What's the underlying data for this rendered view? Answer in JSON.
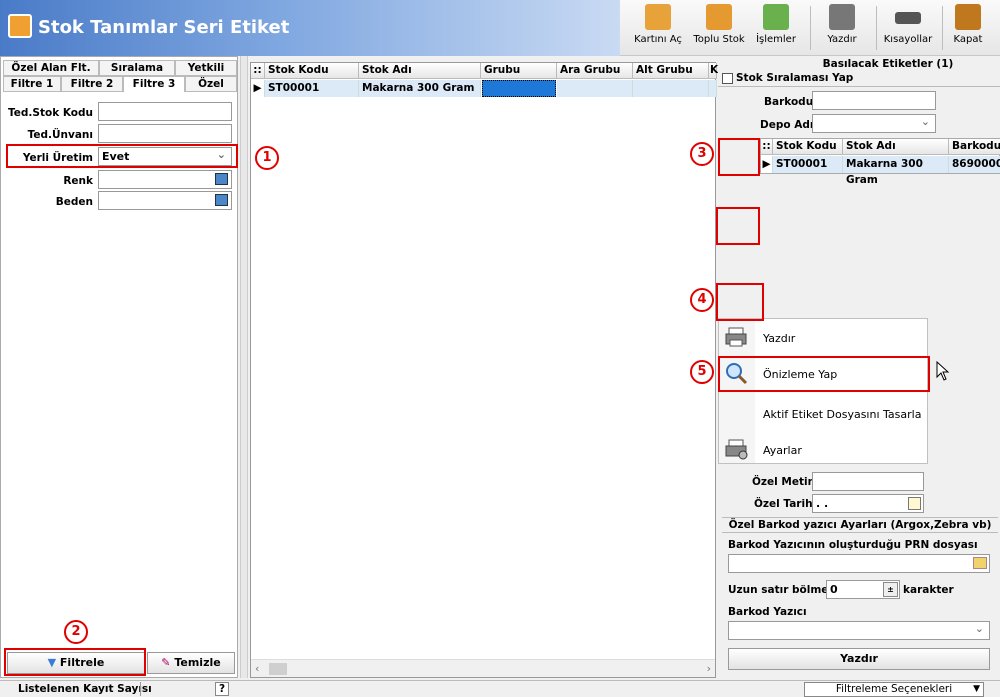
{
  "window": {
    "title": "Stok Tanımlar Seri Etiket"
  },
  "toolbar": {
    "items": [
      "Kartını Aç",
      "Toplu Stok",
      "İşlemler",
      "Yazdır",
      "Kısayollar",
      "Kapat"
    ]
  },
  "left": {
    "tabs_row1": [
      "Özel Alan Flt.",
      "Sıralama",
      "Yetkili"
    ],
    "tabs_row2": [
      "Filtre 1",
      "Filtre 2",
      "Filtre 3",
      "Özel"
    ],
    "fields": {
      "ted_stok_kodu": "Ted.Stok Kodu",
      "ted_unvani": "Ted.Ünvanı",
      "yerli_uretim": "Yerli Üretim",
      "yerli_uretim_value": "Evet",
      "renk": "Renk",
      "beden": "Beden"
    },
    "filter_button": "Filtrele",
    "clear_button": "Temizle"
  },
  "grid": {
    "columns": [
      "Stok Kodu",
      "Stok Adı",
      "Grubu",
      "Ara Grubu",
      "Alt Grubu",
      "K"
    ],
    "rows": [
      [
        "ST00001",
        "Makarna 300 Gram",
        "",
        "",
        "",
        ""
      ]
    ]
  },
  "right": {
    "header": "Basılacak Etiketler (1)",
    "sort_checkbox": "Stok Sıralaması Yap",
    "barkodu_label": "Barkodu",
    "depo_label": "Depo Adı",
    "columns": [
      "Stok Kodu",
      "Stok Adı",
      "Barkodu"
    ],
    "rows": [
      [
        "ST00001",
        "Makarna 300 Gram",
        "8690000"
      ]
    ],
    "ozel_metin": "Özel Metin",
    "ozel_tarih": "Özel Tarih",
    "ozel_tarih_value": ". .",
    "printer_settings": "Özel Barkod yazıcı Ayarları (Argox,Zebra vb)",
    "prn_label": "Barkod Yazıcının oluşturduğu PRN dosyası",
    "uzun_label": "Uzun satır bölme",
    "uzun_value": "0",
    "karakter": "karakter",
    "barkod_yazici": "Barkod Yazıcı",
    "yazdir_button": "Yazdır"
  },
  "menu": {
    "items": [
      "Yazdır",
      "Önizleme Yap",
      "Aktif Etiket Dosyasını Tasarla",
      "Ayarlar"
    ]
  },
  "annotations": [
    "1",
    "2",
    "3",
    "4",
    "5"
  ],
  "status": {
    "record_count": "Listelenen Kayıt Sayısı",
    "help": "?",
    "filter_options": "Filtreleme Seçenekleri"
  },
  "colors": {
    "accent_red": "#e00000",
    "title_blue": "#4a7bc8",
    "selected_cell": "#1e78d8",
    "row_highlight": "#dce9f7",
    "arrow_green": "#3cb371"
  }
}
